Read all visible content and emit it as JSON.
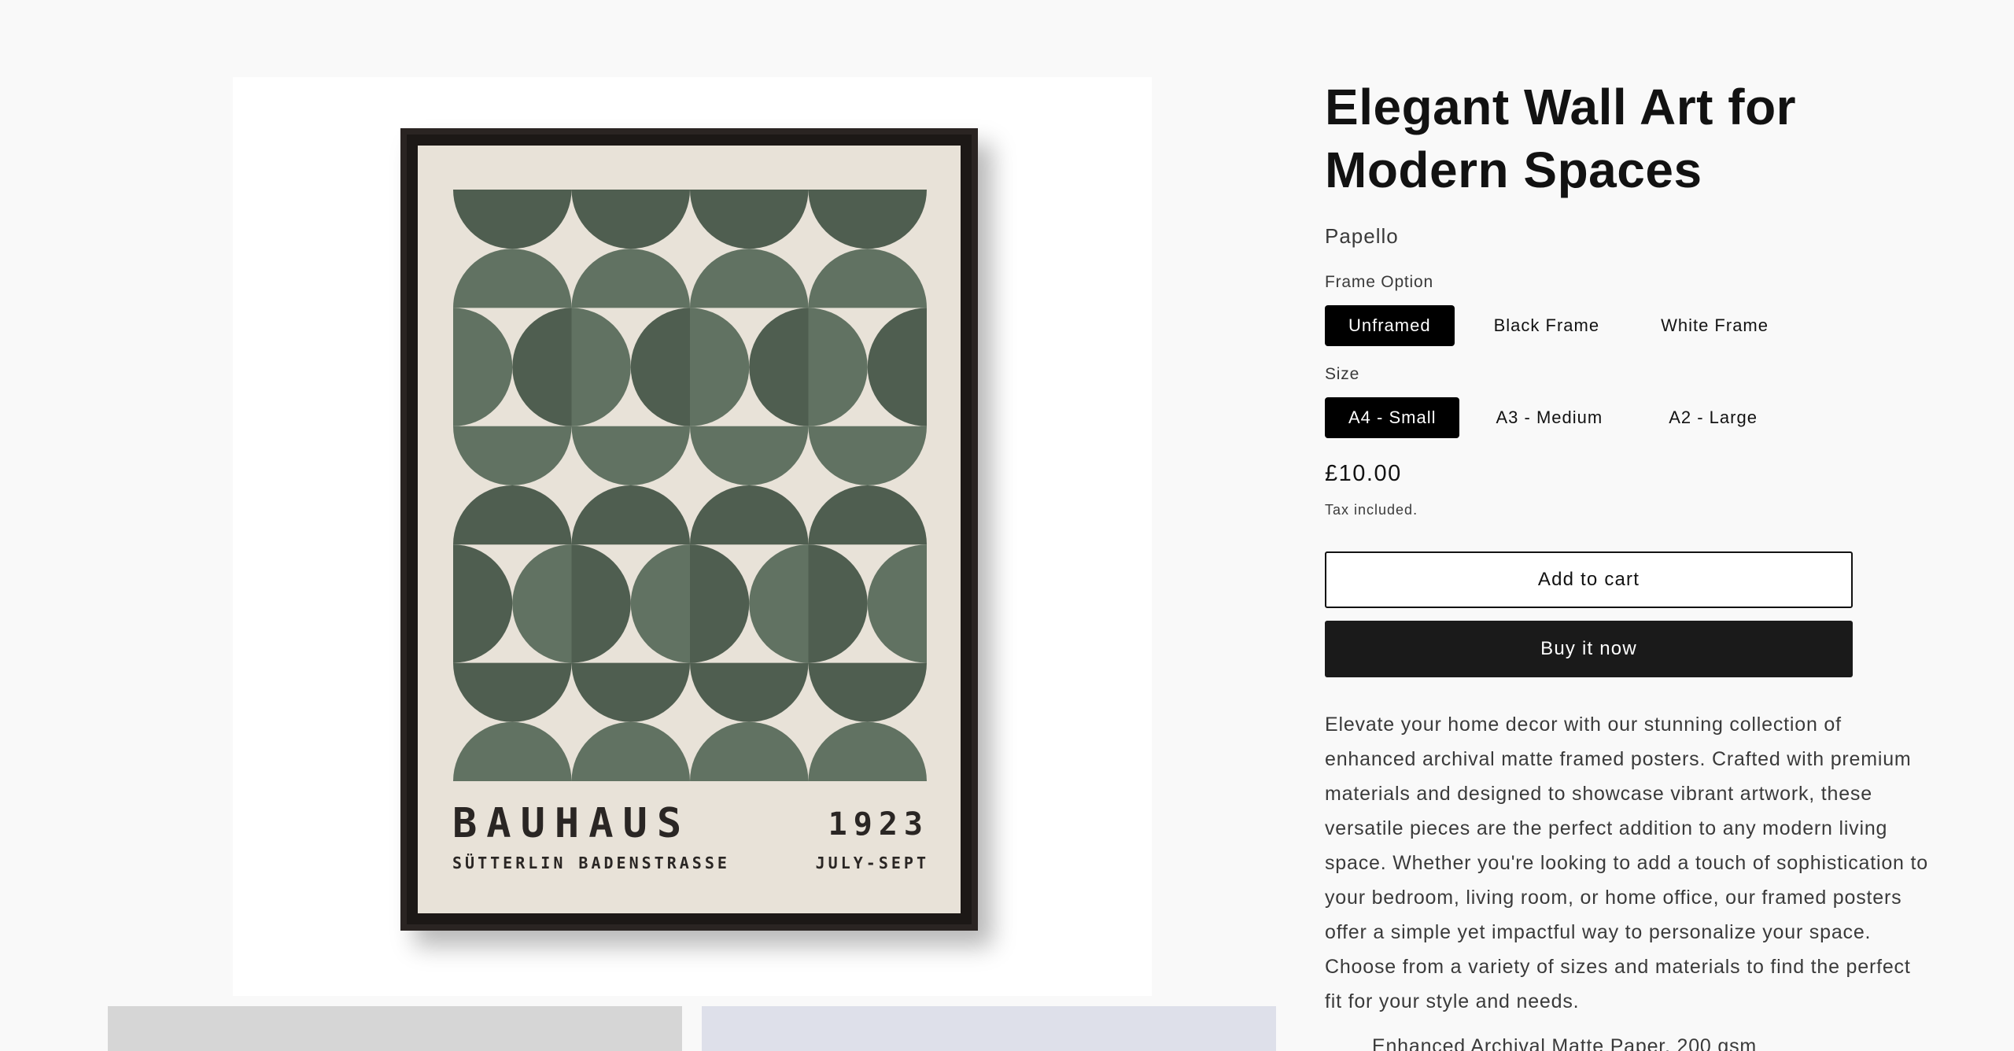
{
  "product": {
    "title": "Elegant Wall Art for Modern Spaces",
    "vendor": "Papello",
    "price": "£10.00",
    "tax_note": "Tax included."
  },
  "poster": {
    "title": "BAUHAUS",
    "subtitle": "SÜTTERLIN BADENSTRASSE",
    "year": "1923",
    "dates": "JULY-SEPT",
    "colors": {
      "background": "#e8e2d8",
      "dark_green": "#4f5e50",
      "light_green": "#617262",
      "frame": "#2a2422"
    }
  },
  "options": {
    "frame": {
      "label": "Frame Option",
      "values": [
        "Unframed",
        "Black Frame",
        "White Frame"
      ],
      "selected": "Unframed"
    },
    "size": {
      "label": "Size",
      "values": [
        "A4 - Small",
        "A3 - Medium",
        "A2 - Large"
      ],
      "selected": "A4 - Small"
    }
  },
  "buttons": {
    "add_to_cart": "Add to cart",
    "buy_now": "Buy it now"
  },
  "description": "Elevate your home decor with our stunning collection of enhanced archival matte framed posters. Crafted with premium materials and designed to showcase vibrant artwork, these versatile pieces are the perfect addition to any modern living space. Whether you're looking to add a touch of sophistication to your bedroom, living room, or home office, our framed posters offer a simple yet impactful way to personalize your space. Choose from a variety of sizes and materials to find the perfect fit for your style and needs.",
  "feature_partial": "Enhanced Archival Matte Paper, 200 gsm"
}
